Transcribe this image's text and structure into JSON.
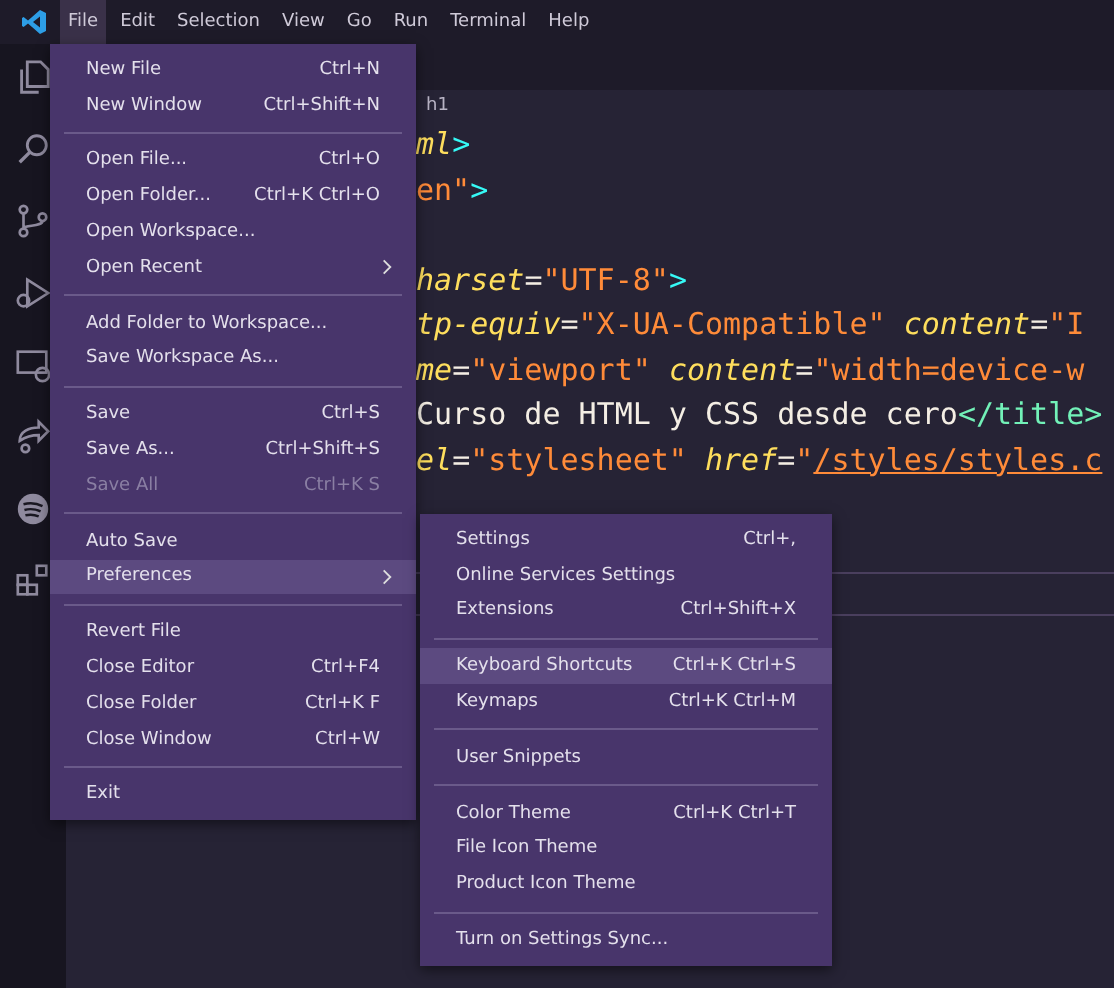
{
  "menubar": [
    {
      "label": "File",
      "selected": true
    },
    {
      "label": "Edit",
      "selected": false
    },
    {
      "label": "Selection",
      "selected": false
    },
    {
      "label": "View",
      "selected": false
    },
    {
      "label": "Go",
      "selected": false
    },
    {
      "label": "Run",
      "selected": false
    },
    {
      "label": "Terminal",
      "selected": false
    },
    {
      "label": "Help",
      "selected": false
    }
  ],
  "breadcrumb": "h1",
  "code_lines": [
    {
      "kind": "code",
      "segments": [
        {
          "kind": "name",
          "text": "ml"
        },
        {
          "kind": "punct",
          "text": ">"
        }
      ]
    },
    {
      "kind": "code",
      "segments": [
        {
          "kind": "str",
          "text": "en\""
        },
        {
          "kind": "punct",
          "text": ">"
        }
      ]
    },
    {
      "kind": "blank"
    },
    {
      "kind": "code",
      "segments": [
        {
          "kind": "attr",
          "text": "harset"
        },
        {
          "kind": "plain",
          "text": "="
        },
        {
          "kind": "str",
          "text": "\"UTF-8\""
        },
        {
          "kind": "punct",
          "text": ">"
        }
      ]
    },
    {
      "kind": "code",
      "segments": [
        {
          "kind": "attr",
          "text": "tp-equiv"
        },
        {
          "kind": "plain",
          "text": "="
        },
        {
          "kind": "str",
          "text": "\"X-UA-Compatible\" "
        },
        {
          "kind": "attr",
          "text": "content"
        },
        {
          "kind": "plain",
          "text": "="
        },
        {
          "kind": "str",
          "text": "\"I"
        }
      ]
    },
    {
      "kind": "code",
      "segments": [
        {
          "kind": "attr",
          "text": "me"
        },
        {
          "kind": "plain",
          "text": "="
        },
        {
          "kind": "str",
          "text": "\"viewport\" "
        },
        {
          "kind": "attr",
          "text": "content"
        },
        {
          "kind": "plain",
          "text": "="
        },
        {
          "kind": "str",
          "text": "\"width=device-w"
        }
      ]
    },
    {
      "kind": "code",
      "segments": [
        {
          "kind": "plain",
          "text": "Curso de HTML y CSS desde cero"
        },
        {
          "kind": "tag",
          "text": "</title>"
        }
      ]
    },
    {
      "kind": "code",
      "segments": [
        {
          "kind": "attr",
          "text": "el"
        },
        {
          "kind": "plain",
          "text": "="
        },
        {
          "kind": "str",
          "text": "\"stylesheet\" "
        },
        {
          "kind": "attr",
          "text": "href"
        },
        {
          "kind": "plain",
          "text": "="
        },
        {
          "kind": "str",
          "text": "\""
        },
        {
          "kind": "link",
          "text": "/styles/styles.c"
        }
      ]
    }
  ],
  "file_menu": [
    {
      "kind": "item",
      "label": "New File",
      "shortcut": "Ctrl+N",
      "disabled": false,
      "selected": false
    },
    {
      "kind": "item",
      "label": "New Window",
      "shortcut": "Ctrl+Shift+N",
      "disabled": false,
      "selected": false
    },
    {
      "kind": "separator"
    },
    {
      "kind": "item",
      "label": "Open File...",
      "shortcut": "Ctrl+O",
      "disabled": false,
      "selected": false
    },
    {
      "kind": "item",
      "label": "Open Folder...",
      "shortcut": "Ctrl+K Ctrl+O",
      "disabled": false,
      "selected": false
    },
    {
      "kind": "item",
      "label": "Open Workspace...",
      "disabled": false,
      "selected": false
    },
    {
      "kind": "submenu",
      "label": "Open Recent",
      "disabled": false,
      "selected": false
    },
    {
      "kind": "separator"
    },
    {
      "kind": "item",
      "label": "Add Folder to Workspace...",
      "disabled": false,
      "selected": false
    },
    {
      "kind": "item",
      "label": "Save Workspace As...",
      "disabled": false,
      "selected": false
    },
    {
      "kind": "separator"
    },
    {
      "kind": "item",
      "label": "Save",
      "shortcut": "Ctrl+S",
      "disabled": false,
      "selected": false
    },
    {
      "kind": "item",
      "label": "Save As...",
      "shortcut": "Ctrl+Shift+S",
      "disabled": false,
      "selected": false
    },
    {
      "kind": "item",
      "label": "Save All",
      "shortcut": "Ctrl+K S",
      "disabled": true,
      "selected": false
    },
    {
      "kind": "separator"
    },
    {
      "kind": "item",
      "label": "Auto Save",
      "disabled": false,
      "selected": false
    },
    {
      "kind": "submenu",
      "label": "Preferences",
      "disabled": false,
      "selected": true
    },
    {
      "kind": "separator"
    },
    {
      "kind": "item",
      "label": "Revert File",
      "disabled": false,
      "selected": false
    },
    {
      "kind": "item",
      "label": "Close Editor",
      "shortcut": "Ctrl+F4",
      "disabled": false,
      "selected": false
    },
    {
      "kind": "item",
      "label": "Close Folder",
      "shortcut": "Ctrl+K F",
      "disabled": false,
      "selected": false
    },
    {
      "kind": "item",
      "label": "Close Window",
      "shortcut": "Ctrl+W",
      "disabled": false,
      "selected": false
    },
    {
      "kind": "separator"
    },
    {
      "kind": "item",
      "label": "Exit",
      "disabled": false,
      "selected": false
    }
  ],
  "preferences_menu": [
    {
      "kind": "item",
      "label": "Settings",
      "shortcut": "Ctrl+,",
      "disabled": false,
      "selected": false
    },
    {
      "kind": "item",
      "label": "Online Services Settings",
      "disabled": false,
      "selected": false
    },
    {
      "kind": "item",
      "label": "Extensions",
      "shortcut": "Ctrl+Shift+X",
      "disabled": false,
      "selected": false
    },
    {
      "kind": "separator"
    },
    {
      "kind": "item",
      "label": "Keyboard Shortcuts",
      "shortcut": "Ctrl+K Ctrl+S",
      "disabled": false,
      "selected": true
    },
    {
      "kind": "item",
      "label": "Keymaps",
      "shortcut": "Ctrl+K Ctrl+M",
      "disabled": false,
      "selected": false
    },
    {
      "kind": "separator"
    },
    {
      "kind": "item",
      "label": "User Snippets",
      "disabled": false,
      "selected": false
    },
    {
      "kind": "separator"
    },
    {
      "kind": "item",
      "label": "Color Theme",
      "shortcut": "Ctrl+K Ctrl+T",
      "disabled": false,
      "selected": false
    },
    {
      "kind": "item",
      "label": "File Icon Theme",
      "disabled": false,
      "selected": false
    },
    {
      "kind": "item",
      "label": "Product Icon Theme",
      "disabled": false,
      "selected": false
    },
    {
      "kind": "separator"
    },
    {
      "kind": "item",
      "label": "Turn on Settings Sync...",
      "disabled": false,
      "selected": false
    }
  ]
}
